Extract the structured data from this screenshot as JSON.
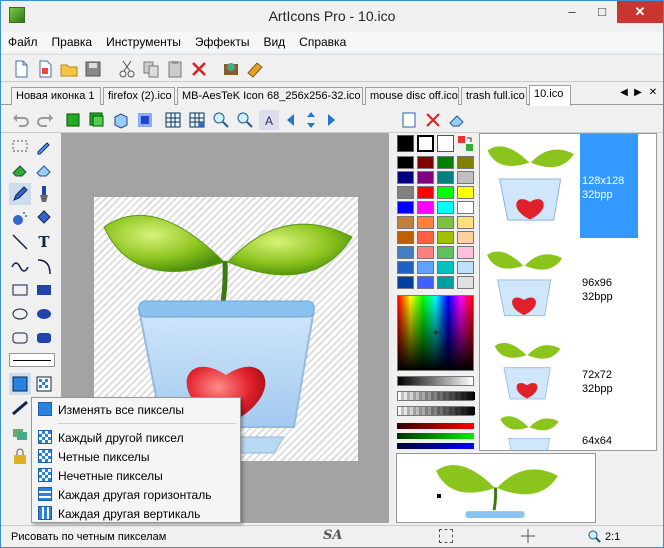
{
  "window": {
    "title": "ArtIcons Pro - 10.ico",
    "minimize": "–",
    "maximize": "□",
    "close": "✕"
  },
  "menu": [
    "Файл",
    "Правка",
    "Инструменты",
    "Эффекты",
    "Вид",
    "Справка"
  ],
  "tabs": [
    {
      "label": "Новая иконка 1",
      "active": false
    },
    {
      "label": "firefox (2).ico",
      "active": false
    },
    {
      "label": "MB-AesTeK Icon 68_256x256-32.ico",
      "active": false
    },
    {
      "label": "mouse disc off.ico",
      "active": false
    },
    {
      "label": "trash full.ico",
      "active": false
    },
    {
      "label": "10.ico",
      "active": true
    }
  ],
  "tabnav": {
    "prev": "◀",
    "next": "▶",
    "close": "✕"
  },
  "tools": {
    "text_tool": "T"
  },
  "formats": [
    {
      "size": "128x128",
      "depth": "32bpp",
      "selected": true
    },
    {
      "size": "96x96",
      "depth": "32bpp",
      "selected": false
    },
    {
      "size": "72x72",
      "depth": "32bpp",
      "selected": false
    },
    {
      "size": "64x64",
      "depth": "",
      "selected": false
    }
  ],
  "popup": {
    "items": [
      {
        "label": "Изменять все пикселы",
        "icon": "all-pixels-icon"
      },
      {
        "label": "Каждый другой пиксел",
        "icon": "every-other-pixel-icon"
      },
      {
        "label": "Четные пикселы",
        "icon": "even-pixels-icon"
      },
      {
        "label": "Нечетные пикселы",
        "icon": "odd-pixels-icon"
      },
      {
        "label": "Каждая другая горизонталь",
        "icon": "every-other-row-icon"
      },
      {
        "label": "Каждая другая вертикаль",
        "icon": "every-other-column-icon"
      }
    ]
  },
  "status": {
    "text": "Рисовать по четным пикселам",
    "zoom": "2:1",
    "watermark": "SA"
  },
  "palette_colors": [
    "#000000",
    "#800000",
    "#008000",
    "#808000",
    "#000080",
    "#800080",
    "#008080",
    "#c0c0c0",
    "#808080",
    "#ff0000",
    "#00ff00",
    "#ffff00",
    "#0000ff",
    "#ff00ff",
    "#00ffff",
    "#ffffff",
    "#c08040",
    "#ff8040",
    "#80c040",
    "#ffe080",
    "#c06000",
    "#ff6040",
    "#a0c000",
    "#ffd0a0",
    "#4080c0",
    "#ff8080",
    "#60c060",
    "#ffc0e0",
    "#2060c0",
    "#60a0ff",
    "#00c0c0",
    "#c0e0ff",
    "#0040a0",
    "#4060ff",
    "#00a0a0",
    "#e0e0e0"
  ],
  "colors": {
    "accent": "#3399ff",
    "canvas_bg": "#a3a3a3",
    "close_btn": "#c7372f"
  }
}
